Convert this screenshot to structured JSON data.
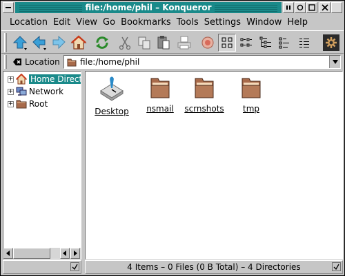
{
  "window": {
    "title": "file:/home/phil  –  Konqueror"
  },
  "menu": [
    "Location",
    "Edit",
    "View",
    "Go",
    "Bookmarks",
    "Tools",
    "Settings",
    "Window",
    "Help"
  ],
  "toolbar": {
    "buttons": [
      "up-arrow-icon",
      "back-arrow-icon",
      "forward-arrow-icon",
      "home-icon",
      "reload-icon",
      "cut-icon",
      "copy-icon",
      "paste-icon",
      "print-icon",
      "stop-icon",
      "icon-view-icon",
      "tree-view-icon",
      "detailed-view-icon",
      "text-view-icon",
      "list-view-icon",
      "konqueror-gear-icon"
    ],
    "pressed": "icon-view-icon"
  },
  "location": {
    "label": "Location",
    "value": "file:/home/phil"
  },
  "tree": {
    "items": [
      {
        "label": "Home Direct",
        "icon": "home-icon",
        "selected": true
      },
      {
        "label": "Network",
        "icon": "network-icon",
        "selected": false
      },
      {
        "label": "Root",
        "icon": "folder-icon",
        "selected": false
      }
    ]
  },
  "files": [
    {
      "name": "Desktop",
      "icon": "desktop-folder-icon"
    },
    {
      "name": "nsmail",
      "icon": "folder-icon"
    },
    {
      "name": "scrnshots",
      "icon": "folder-icon"
    },
    {
      "name": "tmp",
      "icon": "folder-icon"
    }
  ],
  "status": {
    "text": "4 Items – 0 Files (0 B Total) – 4 Directories"
  },
  "colors": {
    "titlebar": "#1a8a8a",
    "selection": "#1a8a8a",
    "chrome": "#c6c6c6",
    "folder": "#a86a4a"
  }
}
